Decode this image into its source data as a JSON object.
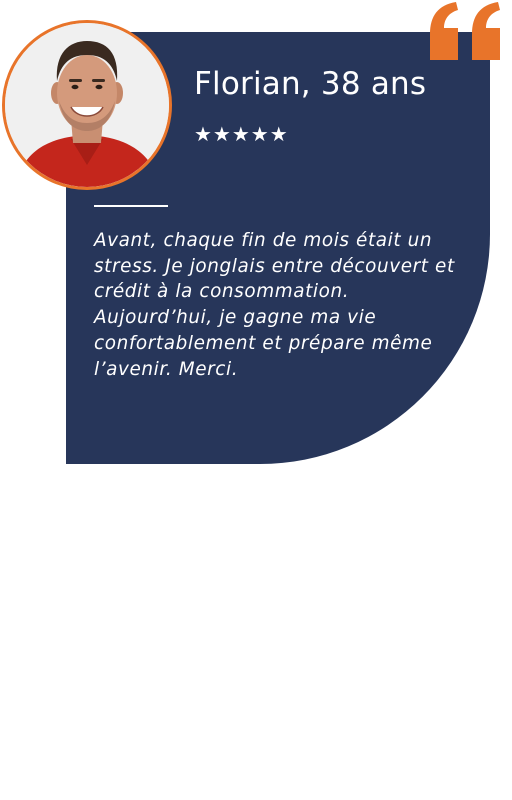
{
  "testimonial_card": {
    "name": "Florian, 38 ans",
    "rating_stars": "★★★★★",
    "rating": 5,
    "text": "Avant, chaque fin de mois était un stress. Je jonglais entre découvert et crédit à la consommation. Aujourd’hui, je gagne ma vie confortablement et prépare même l’avenir. Merci.",
    "avatar_icon": "person-photo",
    "quote_icon": "quote-mark-icon"
  },
  "colors": {
    "card_background": "#27365a",
    "accent_orange": "#e8742a",
    "text": "#ffffff"
  }
}
